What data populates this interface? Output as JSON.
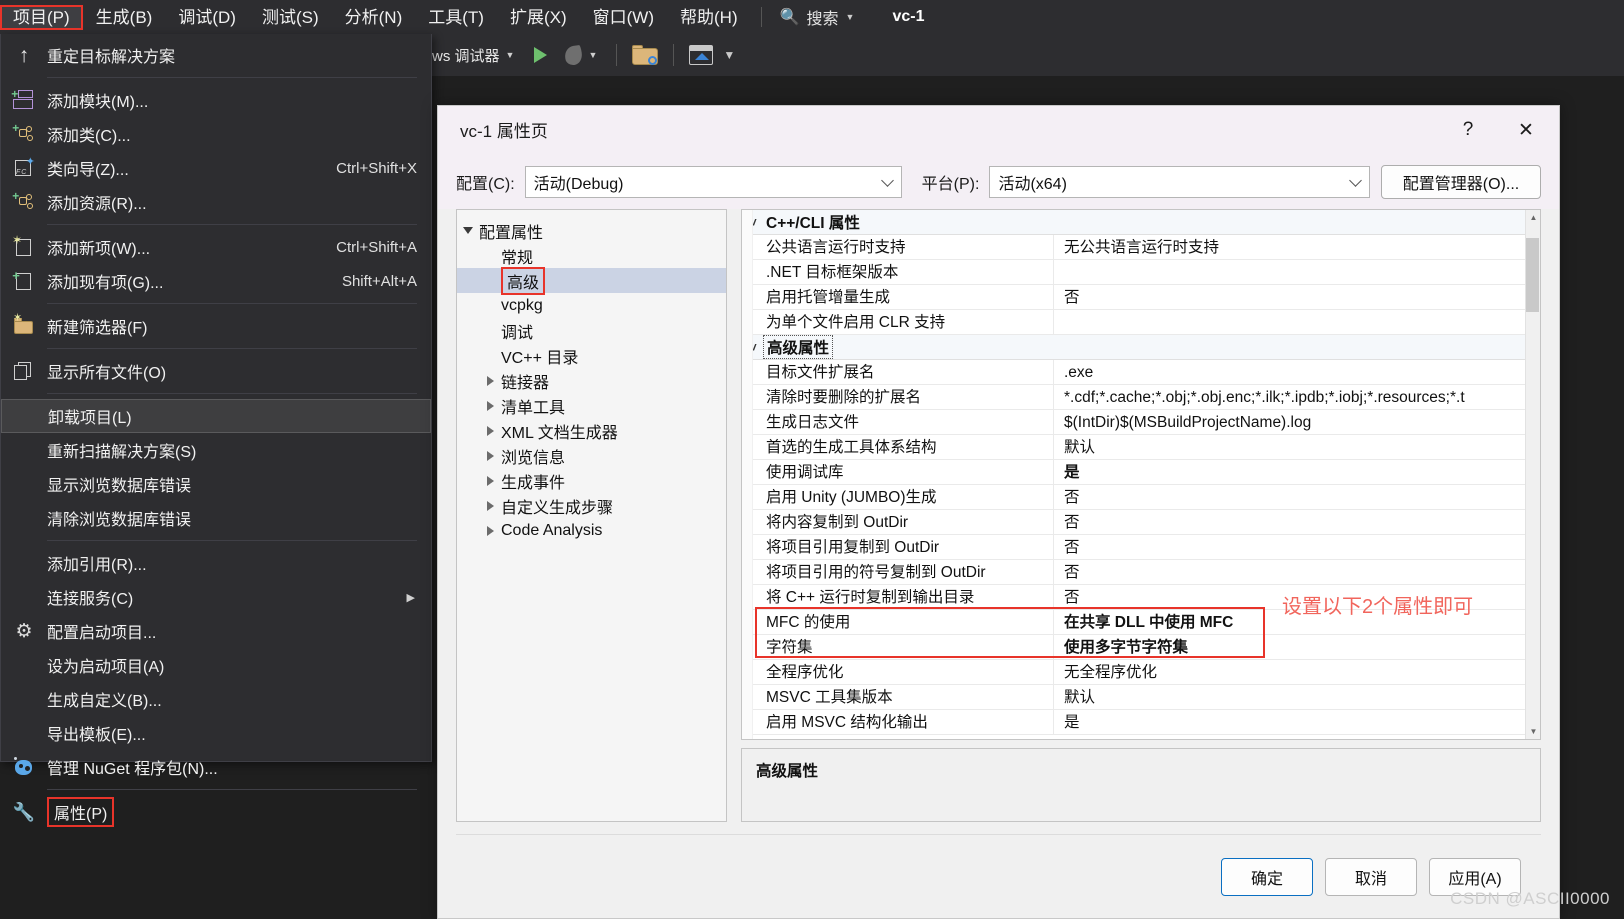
{
  "menubar": {
    "items": [
      {
        "label": "项目(P)",
        "active": true
      },
      {
        "label": "生成(B)",
        "active": false
      },
      {
        "label": "调试(D)",
        "active": false
      },
      {
        "label": "测试(S)",
        "active": false
      },
      {
        "label": "分析(N)",
        "active": false
      },
      {
        "label": "工具(T)",
        "active": false
      },
      {
        "label": "扩展(X)",
        "active": false
      },
      {
        "label": "窗口(W)",
        "active": false
      },
      {
        "label": "帮助(H)",
        "active": false
      }
    ],
    "search_label": "搜索",
    "project_name": "vc-1"
  },
  "toolbar": {
    "debugger_label": "ws 调试器"
  },
  "project_menu": {
    "items": [
      {
        "label": "重定目标解决方案",
        "icon": "arrow-up-icon",
        "accel": "",
        "type": "item"
      },
      {
        "type": "separator"
      },
      {
        "label": "添加模块(M)...",
        "icon": "add-module-icon",
        "accel": "",
        "type": "item"
      },
      {
        "label": "添加类(C)...",
        "icon": "add-class-icon",
        "accel": "",
        "type": "item"
      },
      {
        "label": "类向导(Z)...",
        "icon": "class-wizard-icon",
        "accel": "Ctrl+Shift+X",
        "type": "item"
      },
      {
        "label": "添加资源(R)...",
        "icon": "add-resource-icon",
        "accel": "",
        "type": "item"
      },
      {
        "type": "separator"
      },
      {
        "label": "添加新项(W)...",
        "icon": "new-item-icon",
        "accel": "Ctrl+Shift+A",
        "type": "item"
      },
      {
        "label": "添加现有项(G)...",
        "icon": "existing-item-icon",
        "accel": "Shift+Alt+A",
        "type": "item"
      },
      {
        "type": "separator"
      },
      {
        "label": "新建筛选器(F)",
        "icon": "new-filter-icon",
        "accel": "",
        "type": "item"
      },
      {
        "type": "separator"
      },
      {
        "label": "显示所有文件(O)",
        "icon": "show-all-files-icon",
        "accel": "",
        "type": "item"
      },
      {
        "type": "separator"
      },
      {
        "label": "卸载项目(L)",
        "icon": "",
        "accel": "",
        "type": "item",
        "selected": true
      },
      {
        "label": "重新扫描解决方案(S)",
        "icon": "",
        "accel": "",
        "type": "item"
      },
      {
        "label": "显示浏览数据库错误",
        "icon": "",
        "accel": "",
        "type": "item"
      },
      {
        "label": "清除浏览数据库错误",
        "icon": "",
        "accel": "",
        "type": "item"
      },
      {
        "type": "separator"
      },
      {
        "label": "添加引用(R)...",
        "icon": "",
        "accel": "",
        "type": "item"
      },
      {
        "label": "连接服务(C)",
        "icon": "",
        "accel": "",
        "type": "item",
        "submenu": true
      },
      {
        "label": "配置启动项目...",
        "icon": "gear-icon",
        "accel": "",
        "type": "item"
      },
      {
        "label": "设为启动项目(A)",
        "icon": "",
        "accel": "",
        "type": "item"
      },
      {
        "label": "生成自定义(B)...",
        "icon": "",
        "accel": "",
        "type": "item"
      },
      {
        "label": "导出模板(E)...",
        "icon": "",
        "accel": "",
        "type": "item"
      },
      {
        "label": "管理 NuGet 程序包(N)...",
        "icon": "nuget-icon",
        "accel": "",
        "type": "item"
      },
      {
        "type": "separator"
      },
      {
        "label": "属性(P)",
        "icon": "wrench-icon",
        "accel": "",
        "type": "item",
        "highlighted": true
      }
    ]
  },
  "dialog": {
    "title": "vc-1 属性页",
    "help_glyph": "?",
    "close_glyph": "✕",
    "config_label": "配置(C):",
    "config_value": "活动(Debug)",
    "platform_label": "平台(P):",
    "platform_value": "活动(x64)",
    "config_manager_label": "配置管理器(O)...",
    "tree": [
      {
        "label": "配置属性",
        "level": 1,
        "twisty": "down"
      },
      {
        "label": "常规",
        "level": 2,
        "twisty": "none"
      },
      {
        "label": "高级",
        "level": 2,
        "twisty": "none",
        "selected": true,
        "boxed": true
      },
      {
        "label": "vcpkg",
        "level": 2,
        "twisty": "none"
      },
      {
        "label": "调试",
        "level": 2,
        "twisty": "none"
      },
      {
        "label": "VC++ 目录",
        "level": 2,
        "twisty": "none"
      },
      {
        "label": "链接器",
        "level": 2,
        "twisty": "right"
      },
      {
        "label": "清单工具",
        "level": 2,
        "twisty": "right"
      },
      {
        "label": "XML 文档生成器",
        "level": 2,
        "twisty": "right"
      },
      {
        "label": "浏览信息",
        "level": 2,
        "twisty": "right"
      },
      {
        "label": "生成事件",
        "level": 2,
        "twisty": "right"
      },
      {
        "label": "自定义生成步骤",
        "level": 2,
        "twisty": "right"
      },
      {
        "label": "Code Analysis",
        "level": 2,
        "twisty": "right"
      }
    ],
    "grid": [
      {
        "type": "category",
        "name": "C++/CLI 属性",
        "dotted": false
      },
      {
        "type": "prop",
        "name": "公共语言运行时支持",
        "value": "无公共语言运行时支持",
        "bold": false
      },
      {
        "type": "prop",
        "name": ".NET 目标框架版本",
        "value": "",
        "bold": false
      },
      {
        "type": "prop",
        "name": "启用托管增量生成",
        "value": "否",
        "bold": false
      },
      {
        "type": "prop",
        "name": "为单个文件启用 CLR 支持",
        "value": "",
        "bold": false
      },
      {
        "type": "category",
        "name": "高级属性",
        "dotted": true
      },
      {
        "type": "prop",
        "name": "目标文件扩展名",
        "value": ".exe",
        "bold": false
      },
      {
        "type": "prop",
        "name": "清除时要删除的扩展名",
        "value": "*.cdf;*.cache;*.obj;*.obj.enc;*.ilk;*.ipdb;*.iobj;*.resources;*.t",
        "bold": false
      },
      {
        "type": "prop",
        "name": "生成日志文件",
        "value": "$(IntDir)$(MSBuildProjectName).log",
        "bold": false
      },
      {
        "type": "prop",
        "name": "首选的生成工具体系结构",
        "value": "默认",
        "bold": false
      },
      {
        "type": "prop",
        "name": "使用调试库",
        "value": "是",
        "bold": true
      },
      {
        "type": "prop",
        "name": "启用 Unity (JUMBO)生成",
        "value": "否",
        "bold": false
      },
      {
        "type": "prop",
        "name": "将内容复制到 OutDir",
        "value": "否",
        "bold": false
      },
      {
        "type": "prop",
        "name": "将项目引用复制到 OutDir",
        "value": "否",
        "bold": false
      },
      {
        "type": "prop",
        "name": "将项目引用的符号复制到 OutDir",
        "value": "否",
        "bold": false
      },
      {
        "type": "prop",
        "name": "将 C++ 运行时复制到输出目录",
        "value": "否",
        "bold": false
      },
      {
        "type": "prop",
        "name": "MFC 的使用",
        "value": "在共享 DLL 中使用 MFC",
        "bold": true
      },
      {
        "type": "prop",
        "name": "字符集",
        "value": "使用多字节字符集",
        "bold": true
      },
      {
        "type": "prop",
        "name": "全程序优化",
        "value": "无全程序优化",
        "bold": false
      },
      {
        "type": "prop",
        "name": "MSVC 工具集版本",
        "value": "默认",
        "bold": false
      },
      {
        "type": "prop",
        "name": "启用 MSVC 结构化输出",
        "value": "是",
        "bold": false
      }
    ],
    "annotation": "设置以下2个属性即可",
    "description_title": "高级属性",
    "buttons": {
      "ok": "确定",
      "cancel": "取消",
      "apply": "应用(A)"
    }
  },
  "watermark": "CSDN @ASCII0000",
  "colors": {
    "accent_red": "#e8342a",
    "annotation_red": "#f1655c",
    "selection_blue": "#cbd3e4",
    "primary_button_border": "#0a6fc2"
  }
}
